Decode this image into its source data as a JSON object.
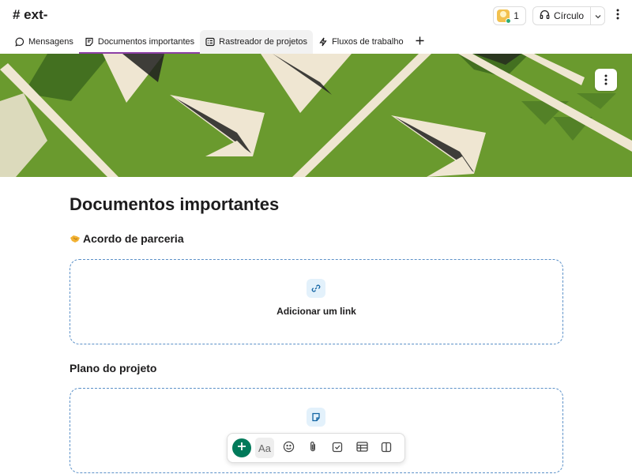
{
  "header": {
    "channel_title": "# ext-",
    "members_count": "1",
    "huddle_label": "Círculo"
  },
  "tabs": [
    {
      "label": "Mensagens",
      "icon": "message-icon"
    },
    {
      "label": "Documentos importantes",
      "icon": "canvas-icon",
      "active": true
    },
    {
      "label": "Rastreador de projetos",
      "icon": "list-icon"
    },
    {
      "label": "Fluxos de trabalho",
      "icon": "workflow-icon"
    }
  ],
  "banner": {
    "colors": {
      "background": "#6a9a2e",
      "planes": "#efe6d2",
      "stripes": "#1f1f1f"
    }
  },
  "document": {
    "title": "Documentos importantes",
    "sections": [
      {
        "heading": "Acordo de parceria",
        "emoji": "handshake-emoji",
        "zone_label": "Adicionar um link",
        "zone_icon": "link-icon"
      },
      {
        "heading": "Plano do projeto",
        "zone_label": "",
        "zone_icon": "canvas-icon"
      }
    ]
  },
  "toolbar": {
    "format_label": "Aa",
    "buttons": [
      "add-icon",
      "format-text",
      "emoji-icon",
      "attachment-icon",
      "checklist-icon",
      "table-icon",
      "columns-icon"
    ]
  },
  "colors": {
    "accent": "#8c3fa5",
    "add_button": "#007a5a",
    "drop_zone_border": "#5b90c8",
    "presence": "#2bac76"
  }
}
